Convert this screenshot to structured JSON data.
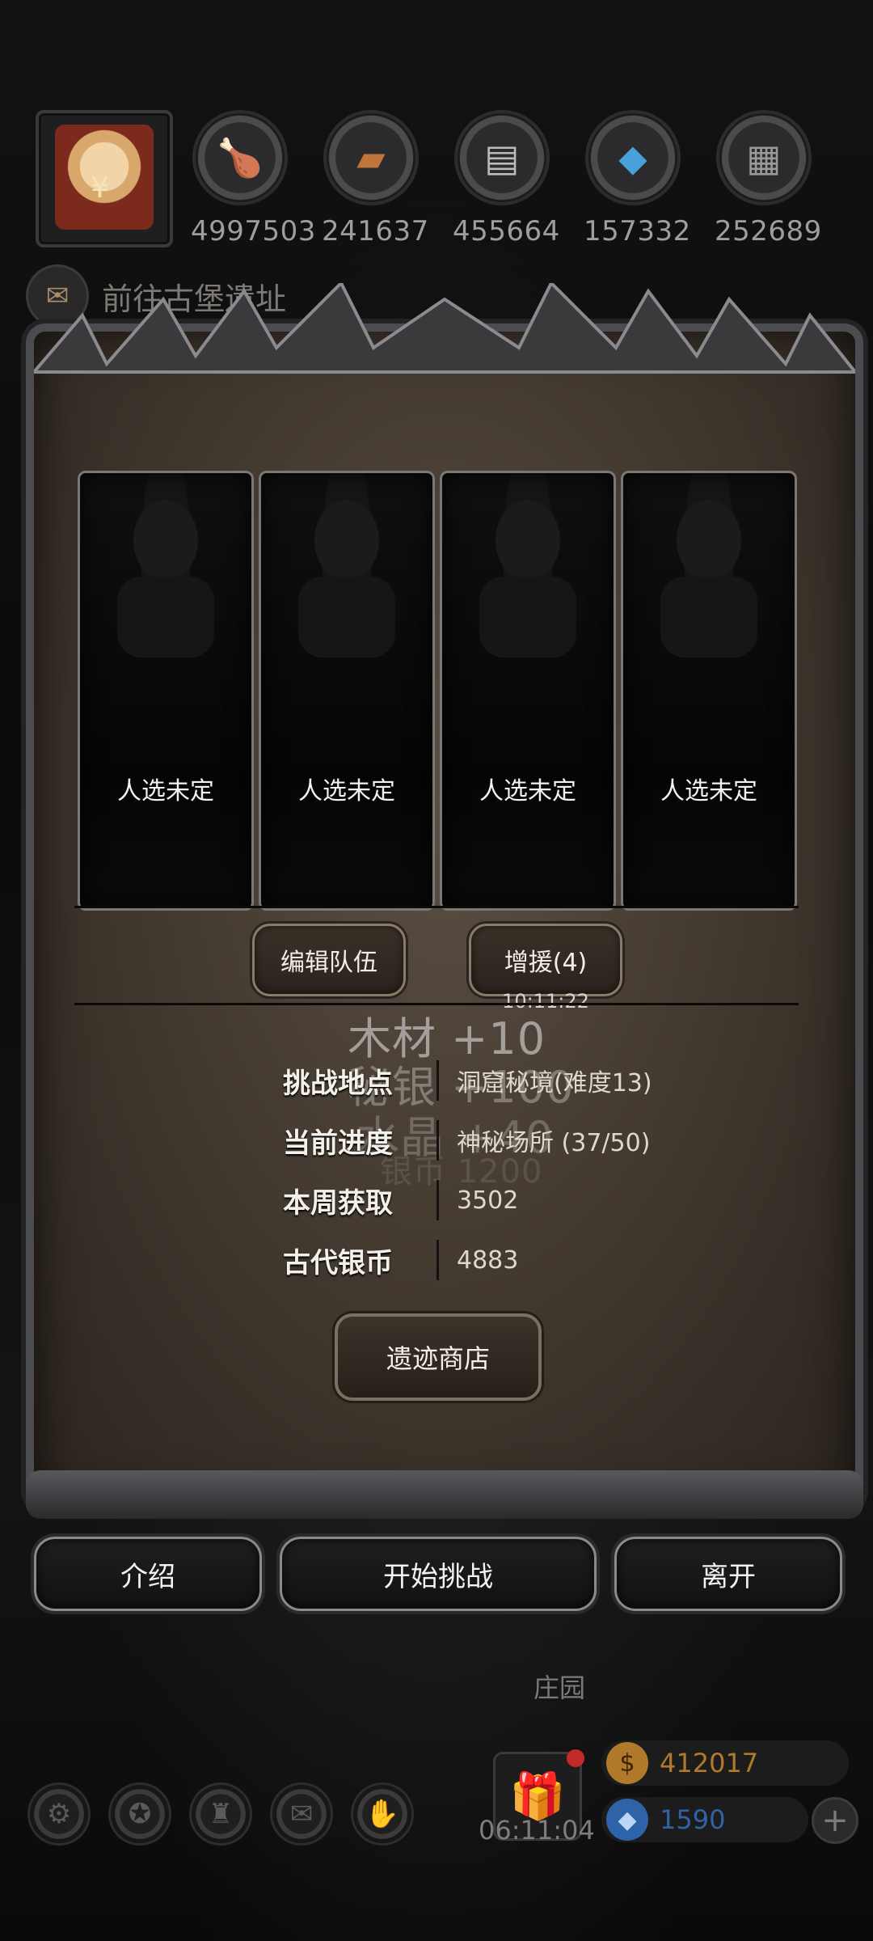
{
  "top_bar": {
    "resources": [
      {
        "icon": "meat-icon",
        "value": "4997503"
      },
      {
        "icon": "wood-icon",
        "value": "241637"
      },
      {
        "icon": "stone-icon",
        "value": "455664"
      },
      {
        "icon": "crystal-icon",
        "value": "157332"
      },
      {
        "icon": "iron-icon",
        "value": "252689"
      }
    ]
  },
  "quest": {
    "label": "前往古堡遗址"
  },
  "team": {
    "slots": [
      {
        "label": "人选未定"
      },
      {
        "label": "人选未定"
      },
      {
        "label": "人选未定"
      },
      {
        "label": "人选未定"
      }
    ],
    "edit_label": "编辑队伍",
    "reinforce_label": "增援(4)",
    "reinforce_timer": "10:11:22"
  },
  "floating": {
    "line1": "木材 +10",
    "line2": "秘银 +100",
    "line3": "水晶 +40",
    "line4": "银币 1200"
  },
  "info": [
    {
      "key": "挑战地点",
      "value": "洞窟秘境(难度13)"
    },
    {
      "key": "当前进度",
      "value": "神秘场所 (37/50)"
    },
    {
      "key": "本周获取",
      "value": "3502"
    },
    {
      "key": "古代银币",
      "value": "4883"
    }
  ],
  "shop_label": "遗迹商店",
  "buttons": {
    "intro": "介绍",
    "start": "开始挑战",
    "leave": "离开"
  },
  "bottom": {
    "location": "庄园",
    "gift_timer": "06:11:04",
    "gold": "412017",
    "gems": "1590",
    "colors": {
      "gold": "#b07a2a",
      "gems": "#2f63a8"
    }
  }
}
